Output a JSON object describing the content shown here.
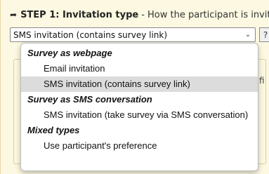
{
  "step": {
    "title": "STEP 1: Invitation type",
    "description": "- How the participant is invited"
  },
  "select": {
    "value": "SMS invitation (contains survey link)",
    "help_label": "?"
  },
  "background": {
    "frag_f": "fi"
  },
  "dropdown": {
    "groups": [
      {
        "label": "Survey as webpage",
        "options": [
          {
            "label": "Email invitation",
            "selected": false
          },
          {
            "label": "SMS invitation (contains survey link)",
            "selected": true
          }
        ]
      },
      {
        "label": "Survey as SMS conversation",
        "options": [
          {
            "label": "SMS invitation (take survey via SMS conversation)",
            "selected": false
          }
        ]
      },
      {
        "label": "Mixed types",
        "options": [
          {
            "label": "Use participant's preference",
            "selected": false
          }
        ]
      }
    ]
  }
}
